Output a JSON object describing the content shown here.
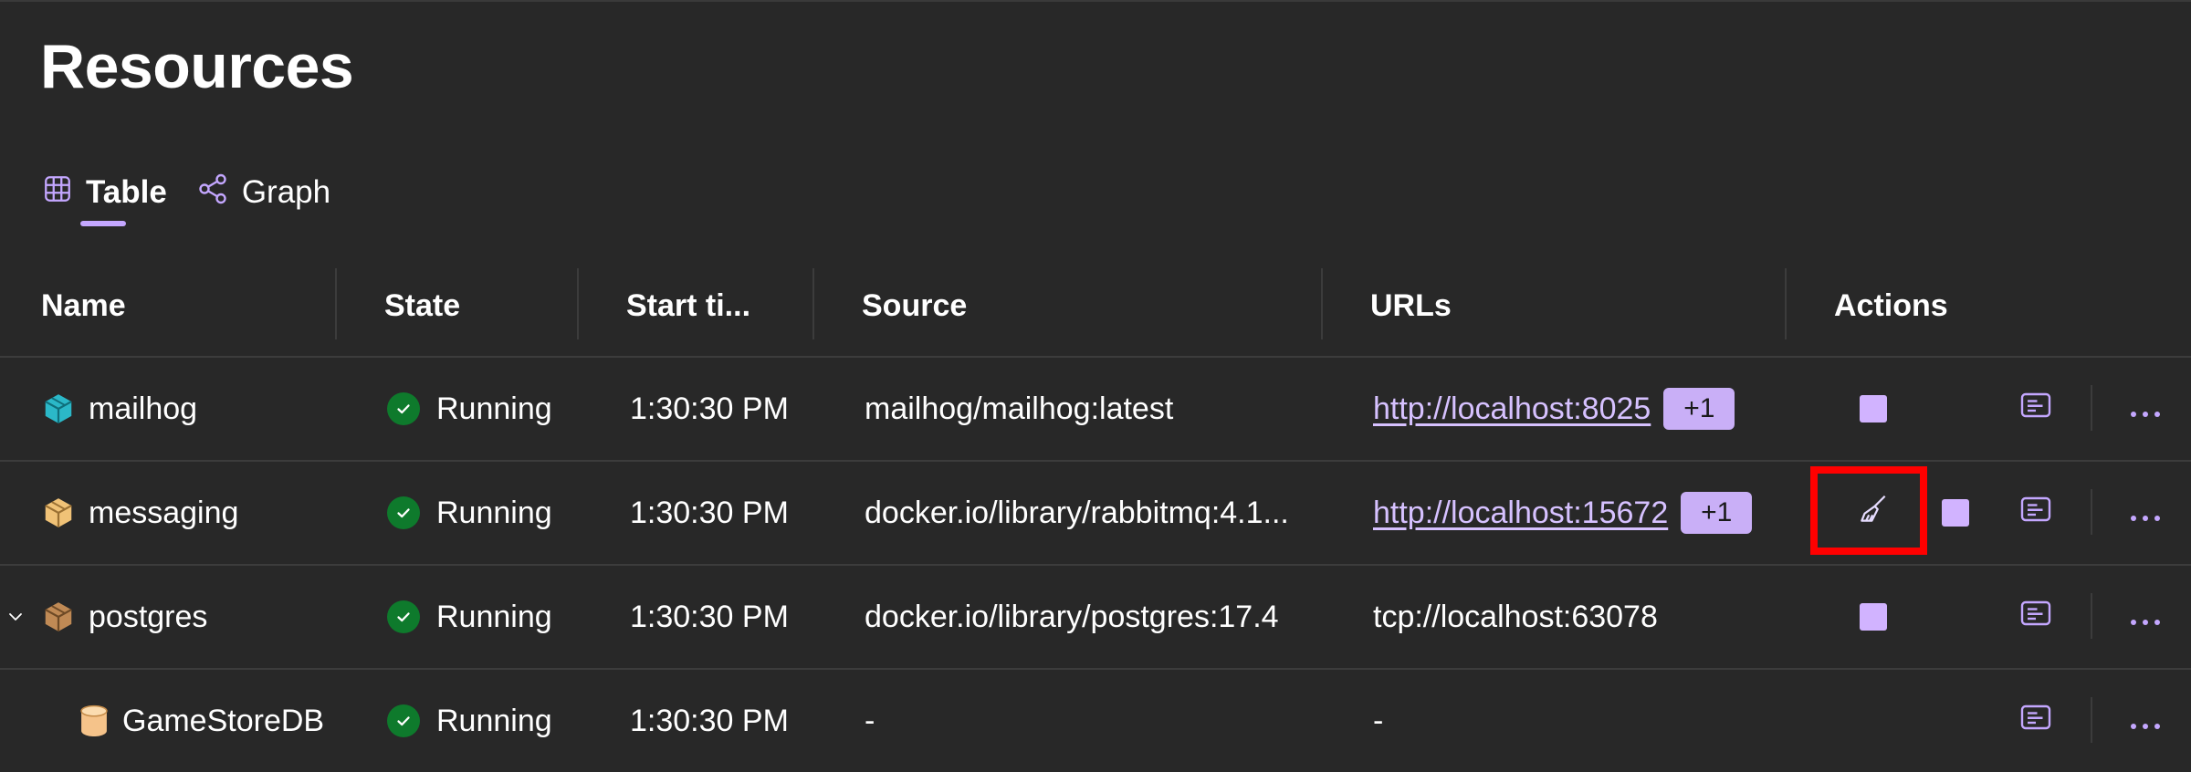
{
  "page": {
    "title": "Resources"
  },
  "tabs": [
    {
      "label": "Table",
      "icon": "table-icon",
      "active": true
    },
    {
      "label": "Graph",
      "icon": "graph-icon",
      "active": false
    }
  ],
  "columns": {
    "name": "Name",
    "state": "State",
    "start_time": "Start ti...",
    "source": "Source",
    "urls": "URLs",
    "actions": "Actions"
  },
  "rows": [
    {
      "name": "mailhog",
      "icon": "container-icon",
      "state": "Running",
      "start_time": "1:30:30 PM",
      "source": "mailhog/mailhog:latest",
      "url": "http://localhost:8025",
      "url_badge": "+1"
    },
    {
      "name": "messaging",
      "icon": "container-icon",
      "state": "Running",
      "start_time": "1:30:30 PM",
      "source": "docker.io/library/rabbitmq:4.1...",
      "url": "http://localhost:15672",
      "url_badge": "+1"
    },
    {
      "name": "postgres",
      "icon": "container-icon",
      "state": "Running",
      "start_time": "1:30:30 PM",
      "source": "docker.io/library/postgres:17.4",
      "url": "tcp://localhost:63078"
    },
    {
      "name": "GameStoreDB",
      "icon": "database-icon",
      "state": "Running",
      "start_time": "1:30:30 PM",
      "source": "-",
      "url": "-"
    }
  ],
  "colors": {
    "background": "#282828",
    "accent": "#c4a7ff",
    "running": "#0e7a2c",
    "highlight": "#ff0000",
    "mailhog_icon": "#2bb8c8",
    "messaging_icon": "#f0c277",
    "postgres_icon": "#c08a55",
    "db_icon": "#f5c38a"
  }
}
